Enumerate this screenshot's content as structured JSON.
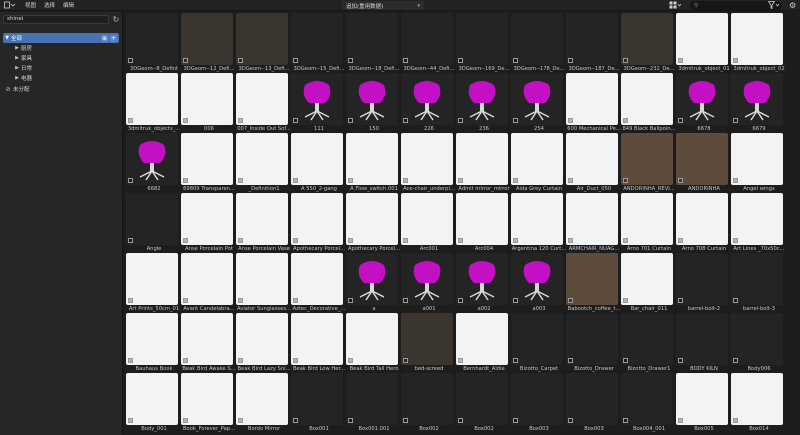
{
  "menu": {
    "view": "视图",
    "select": "选择",
    "edit": "编辑"
  },
  "catalog_selector": {
    "value": "追加(重用数据)"
  },
  "search": {
    "placeholder": ""
  },
  "library": {
    "value": "shinei"
  },
  "tree": {
    "root": "全部",
    "children": [
      "厨房",
      "家具",
      "日常",
      "电器"
    ],
    "unassigned": "未分配"
  },
  "assets": [
    [
      "3DGeom--8_Defint",
      "3DGeom--12_Defi...",
      "3DGeom--13_Defi...",
      "3DGeom--15_Defi...",
      "3DGeom--18_Defi...",
      "3DGeom--44_Defi...",
      "3DGeom--169_De...",
      "3DGeom--178_De...",
      "3DGeom--187_De...",
      "3DGeom--232_De...",
      "3dmitruk_object_01",
      "3dmitruk_object_02"
    ],
    [
      "3dmitruk_objects_...",
      "006",
      "007_Inside Out Sof...",
      "111",
      "150",
      "226",
      "236",
      "254",
      "600 Mechanical Pe...",
      "849 Black Ballpoin...",
      "6678",
      "6679"
    ],
    [
      "6682",
      "69809 Transparen...",
      "_Definition1",
      "A 550_2-gang",
      "A Flow_switch.001",
      "Ace-chair_underpl...",
      "Admit mirror_mirror",
      "Aida Grey Curtain",
      "Air_Duct_050",
      "ANDORINHA_REVI...",
      "ANDORINHA",
      "Angel wings"
    ],
    [
      "Angle",
      "Anse Porcelain Pot",
      "Anse Porcelain Vase",
      "Apothecary Porcel...",
      "Apothecary Porcel...",
      "Arc001",
      "Arc004",
      "Argentina 120 Curt...",
      "ARMCHAIR_NUAG...",
      "Arno 701 Curtain",
      "Arno 708 Curtain",
      "Art Lines _70x50c..."
    ],
    [
      "Art Prints_50cm_01",
      "Avant Candelabra...",
      "Aviator Sunglasses...",
      "Aztec_Decorative_...",
      "a",
      "a001",
      "a002",
      "a003",
      "Babootch_coffee_t...",
      "Bar_chair_011",
      "barrel-bolt-2",
      "barrel-bolt-3"
    ],
    [
      "Bauhaus Book",
      "Beak Bird Awake S...",
      "Beak Bird Lazy Sni...",
      "Beak Bird Low Her...",
      "Beak Bird Tall Hero",
      "bed-screed",
      "Bernhardt_Aldie",
      "Bizotto_Carpet",
      "Bizotto_Drawer",
      "Bizotto_Drawer1",
      "BODY KILN",
      "Body006"
    ],
    [
      "Body_001",
      "Book_Forever_Pap...",
      "Bordo Mirror",
      "Box001",
      "Box001.001",
      "Box002",
      "Box002",
      "Box003",
      "Box003",
      "Box004_001",
      "Box005",
      "Box014"
    ]
  ],
  "colors": {
    "accent": "#4772b3",
    "magenta_chair": "#c410c4",
    "background": "#1d1d1d",
    "panel": "#262626"
  }
}
